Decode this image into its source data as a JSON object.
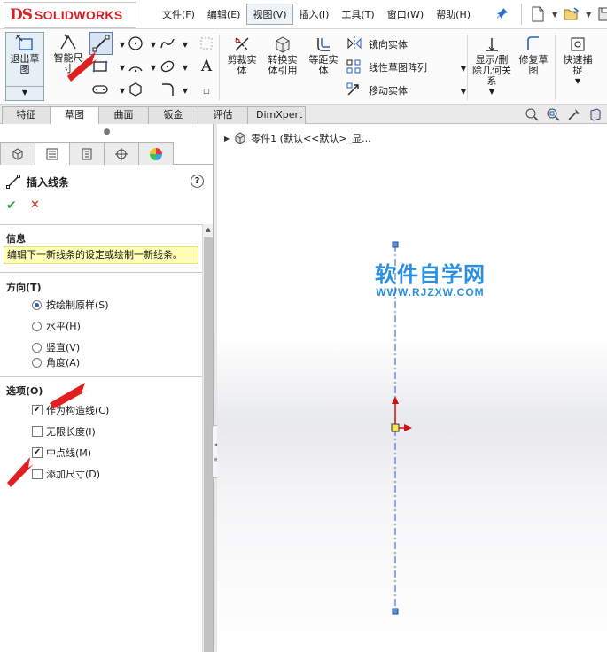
{
  "app": {
    "logo_mark": "DS",
    "logo_text": "SOLIDWORKS"
  },
  "menu": [
    {
      "label": "文件(F)",
      "active": false
    },
    {
      "label": "编辑(E)",
      "active": false
    },
    {
      "label": "视图(V)",
      "active": true
    },
    {
      "label": "插入(I)",
      "active": false
    },
    {
      "label": "工具(T)",
      "active": false
    },
    {
      "label": "窗口(W)",
      "active": false
    },
    {
      "label": "帮助(H)",
      "active": false
    }
  ],
  "ribbon": {
    "exit_sketch": "退出草图",
    "smart_dimension": "智能尺寸",
    "trim": "剪裁实体",
    "convert": "转换实体引用",
    "offset": "等距实体",
    "mirror": "镜向实体",
    "linear_pattern": "线性草图阵列",
    "move": "移动实体",
    "display_relations": "显示/删除几何关系",
    "repair": "修复草图",
    "quick_snap": "快速捕捉"
  },
  "tabs": [
    {
      "label": "特征",
      "active": false
    },
    {
      "label": "草图",
      "active": true
    },
    {
      "label": "曲面",
      "active": false
    },
    {
      "label": "钣金",
      "active": false
    },
    {
      "label": "评估",
      "active": false
    },
    {
      "label": "DimXpert",
      "active": false
    }
  ],
  "panel": {
    "title": "插入线条",
    "help": "?",
    "info_header": "信息",
    "info_text": "编辑下一新线条的设定或绘制一新线条。",
    "direction_header": "方向(T)",
    "direction_options": [
      {
        "label": "按绘制原样(S)",
        "selected": true
      },
      {
        "label": "水平(H)",
        "selected": false
      },
      {
        "label": "竖直(V)",
        "selected": false
      },
      {
        "label": "角度(A)",
        "selected": false
      }
    ],
    "options_header": "选项(O)",
    "options": [
      {
        "label": "作为构造线(C)",
        "checked": true
      },
      {
        "label": "无限长度(I)",
        "checked": false
      },
      {
        "label": "中点线(M)",
        "checked": true
      },
      {
        "label": "添加尺寸(D)",
        "checked": false
      }
    ]
  },
  "tree": {
    "root_label": "零件1  (默认<<默认>_显..."
  },
  "watermark": {
    "cn": "软件自学网",
    "en": "WWW.RJZXW.COM"
  },
  "colors": {
    "accent": "#2a8fe0",
    "annotation_red": "#e02020",
    "sketch_line": "#2060c8",
    "origin_red": "#d01010"
  }
}
